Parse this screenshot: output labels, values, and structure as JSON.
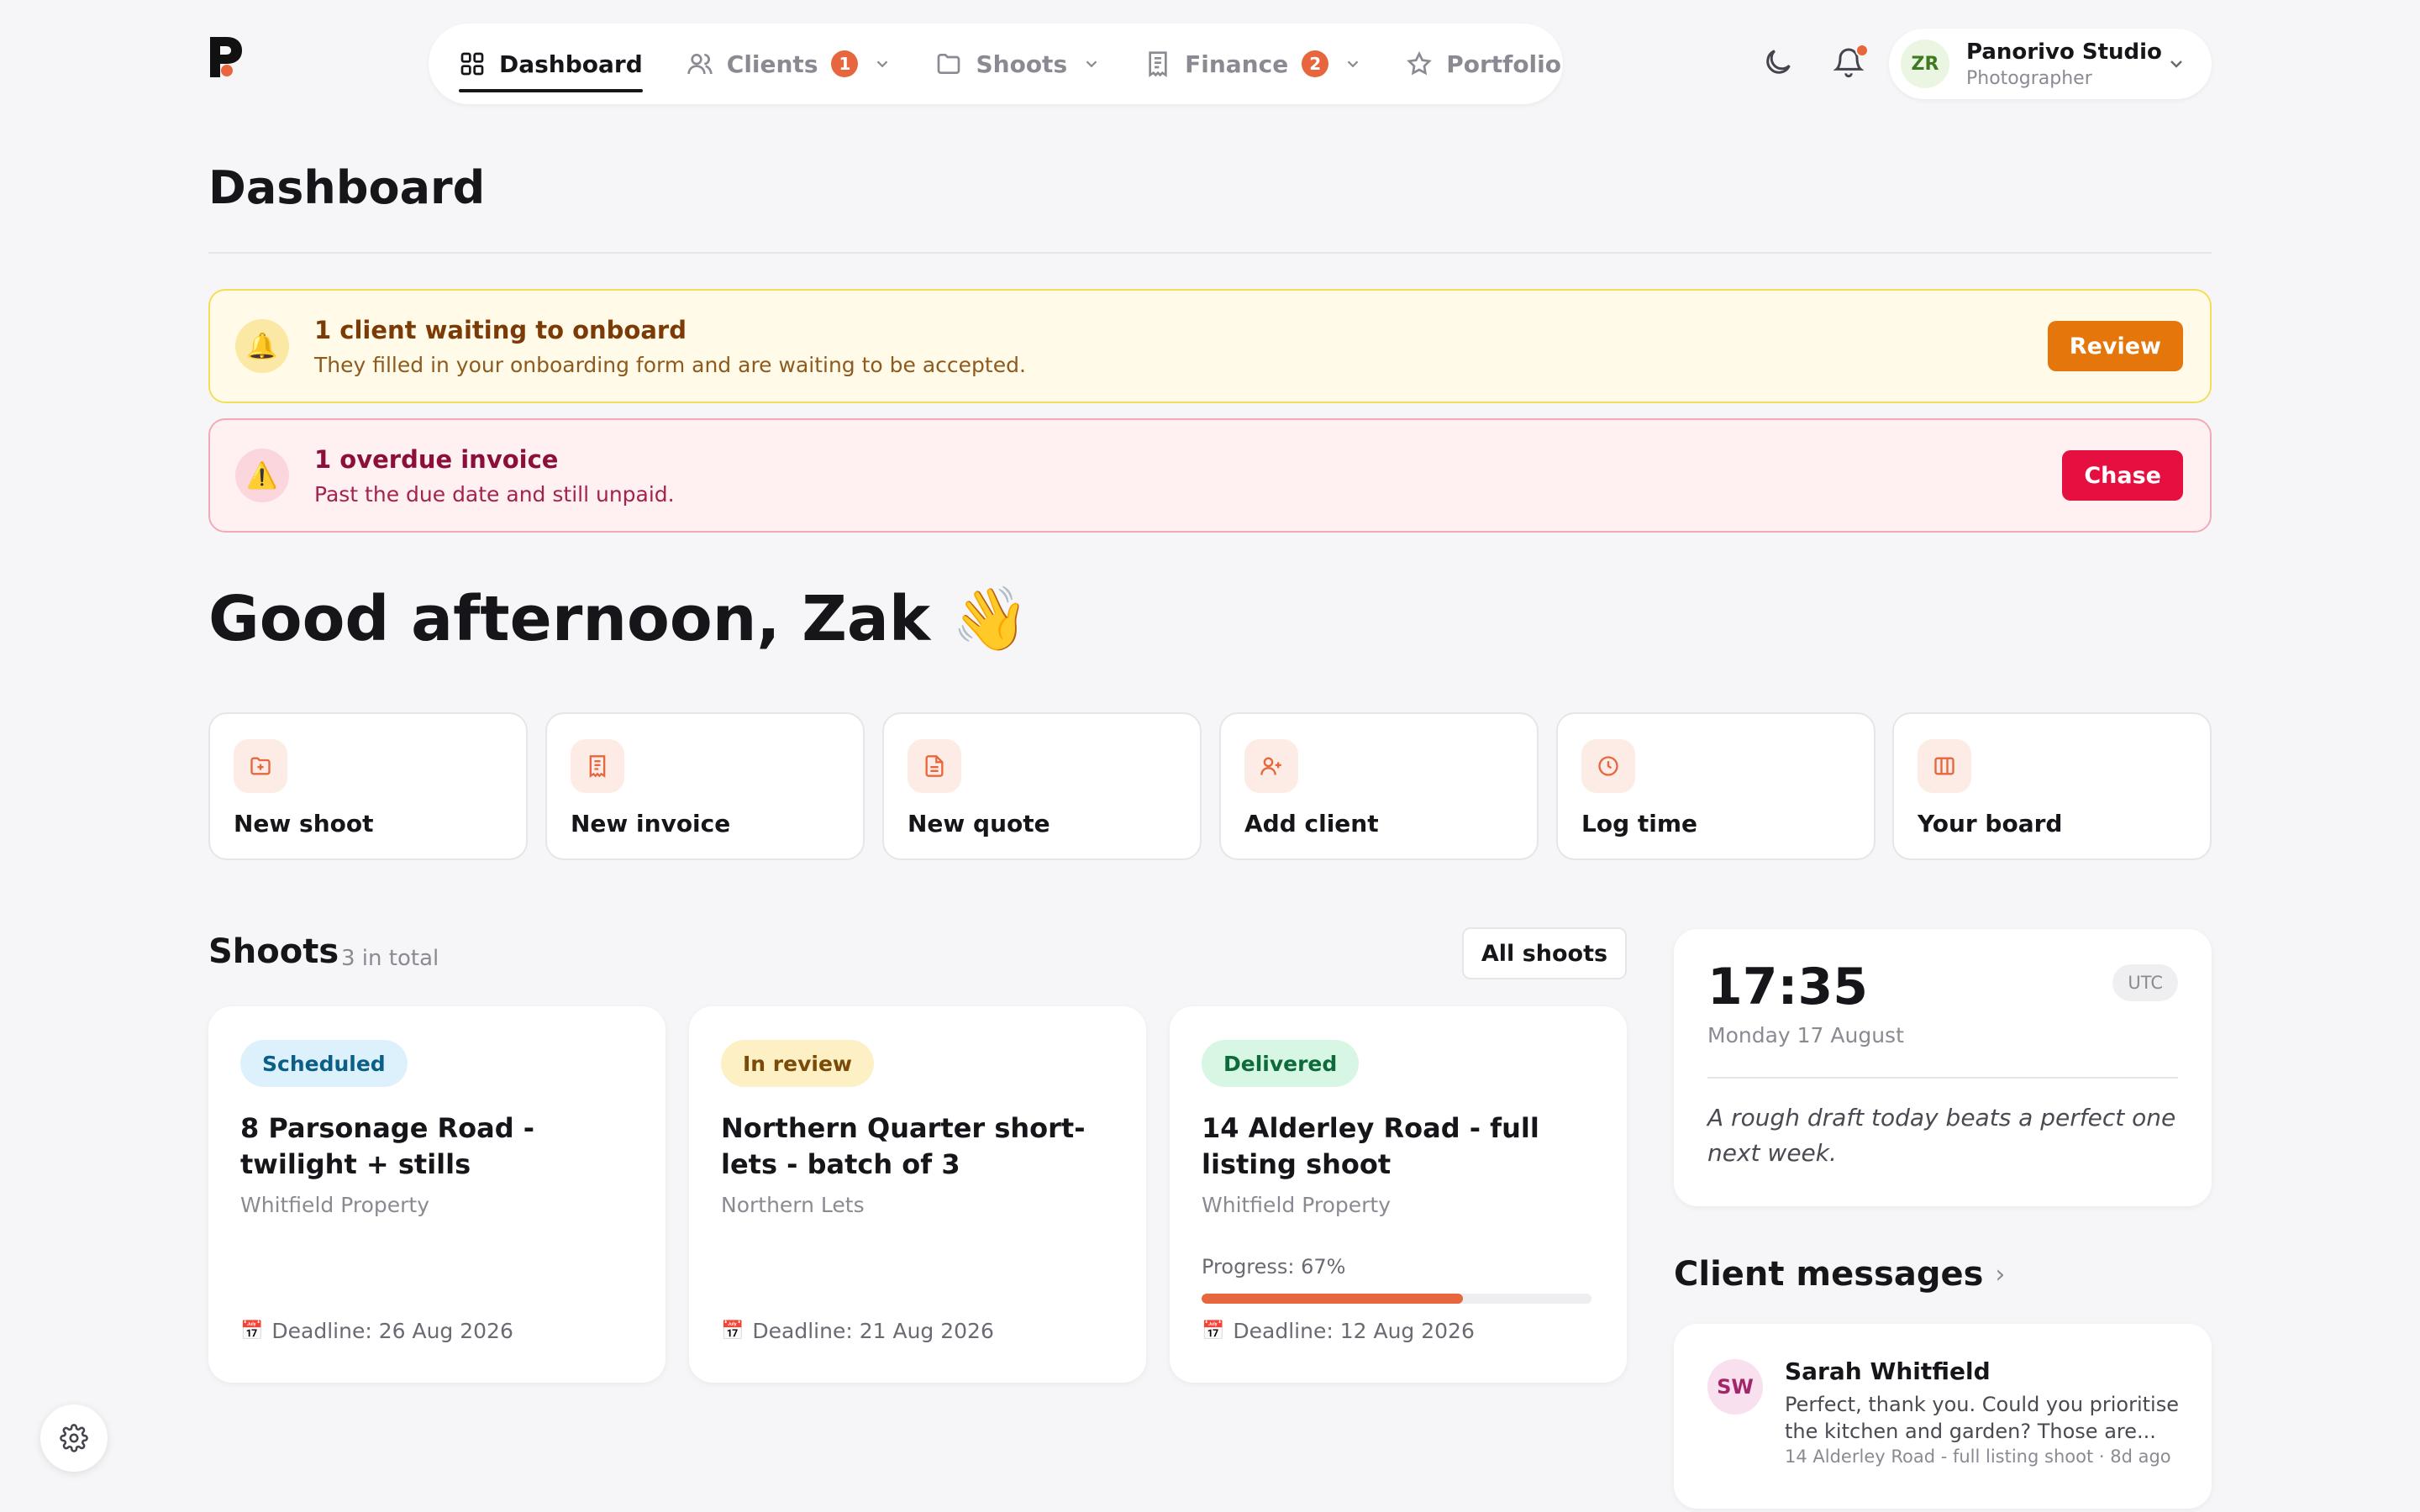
{
  "nav": {
    "items": [
      {
        "label": "Dashboard",
        "icon": "grid-icon",
        "active": true
      },
      {
        "label": "Clients",
        "icon": "users-icon",
        "badge": "1",
        "dropdown": true
      },
      {
        "label": "Shoots",
        "icon": "folder-icon",
        "dropdown": true
      },
      {
        "label": "Finance",
        "icon": "receipt-icon",
        "badge": "2",
        "dropdown": true
      },
      {
        "label": "Portfolio",
        "icon": "star-icon"
      }
    ]
  },
  "header": {
    "theme_icon": "moon-icon",
    "notification_icon": "bell-icon",
    "user": {
      "initials": "ZR",
      "name": "Panorivo Studio",
      "role": "Photographer"
    }
  },
  "page": {
    "title": "Dashboard",
    "greeting": "Good afternoon, Zak 👋"
  },
  "alerts": [
    {
      "icon": "🔔",
      "title": "1 client waiting to onboard",
      "desc": "They filled in your onboarding form and are waiting to be accepted.",
      "action": "Review",
      "color": "#e4760c"
    },
    {
      "icon": "⚠️",
      "title": "1 overdue invoice",
      "desc": "Past the due date and still unpaid.",
      "action": "Chase",
      "color": "#e5103f"
    }
  ],
  "quick_actions": [
    {
      "label": "New shoot",
      "icon": "folder-plus-icon"
    },
    {
      "label": "New invoice",
      "icon": "receipt-icon"
    },
    {
      "label": "New quote",
      "icon": "document-icon"
    },
    {
      "label": "Add client",
      "icon": "user-plus-icon"
    },
    {
      "label": "Log time",
      "icon": "clock-icon"
    },
    {
      "label": "Your board",
      "icon": "columns-icon"
    }
  ],
  "shoots": {
    "title": "Shoots",
    "count": "3 in total",
    "all_button": "All shoots",
    "items": [
      {
        "status": "Scheduled",
        "title": "8 Parsonage Road - twilight + stills",
        "client": "Whitfield Property",
        "deadline": "Deadline: 26 Aug 2026"
      },
      {
        "status": "In review",
        "title": "Northern Quarter short-lets - batch of 3",
        "client": "Northern Lets",
        "deadline": "Deadline: 21 Aug 2026"
      },
      {
        "status": "Delivered",
        "title": "14 Alderley Road - full listing shoot",
        "client": "Whitfield Property",
        "progress_label": "Progress: 67%",
        "progress": 0.67,
        "deadline": "Deadline: 12 Aug 2026"
      }
    ]
  },
  "clock": {
    "time": "17:35",
    "timezone": "UTC",
    "date": "Monday 17 August",
    "quote": "A rough draft today beats a perfect one next week."
  },
  "messages": {
    "title": "Client messages",
    "items": [
      {
        "initials": "SW",
        "name": "Sarah Whitfield",
        "body": "Perfect, thank you. Could you prioritise the kitchen and garden? Those are...",
        "meta": "14 Alderley Road - full listing shoot · 8d ago"
      }
    ]
  },
  "colors": {
    "accent": "#e8663d",
    "background": "#f6f6f8"
  }
}
